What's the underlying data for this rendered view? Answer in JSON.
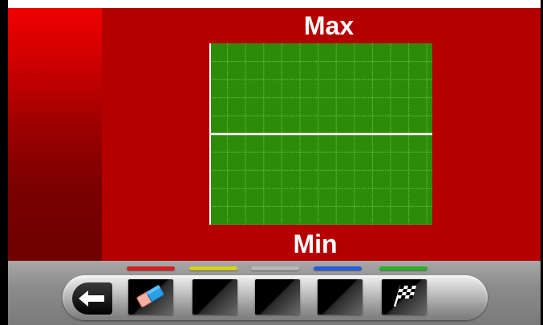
{
  "screen": {
    "max_label": "Max",
    "min_label": "Min"
  },
  "plot": {
    "grid": true,
    "background_color": "#2e8b0a",
    "grid_color": "#6fd14a",
    "centerline_color": "#ffffff"
  },
  "toolbar": {
    "indicators": [
      {
        "name": "red-indicator",
        "color": "#d62020"
      },
      {
        "name": "yellow-indicator",
        "color": "#d8d020"
      },
      {
        "name": "gray-indicator",
        "color": "#b8b8b8"
      },
      {
        "name": "blue-indicator",
        "color": "#2a5cd6"
      },
      {
        "name": "green-indicator",
        "color": "#2fb02a"
      }
    ],
    "buttons": [
      {
        "name": "back-button",
        "icon": "arrow-left-icon"
      },
      {
        "name": "erase-button",
        "icon": "eraser-icon"
      },
      {
        "name": "blank-button-1",
        "icon": "none"
      },
      {
        "name": "blank-button-2",
        "icon": "none"
      },
      {
        "name": "blank-button-3",
        "icon": "none"
      },
      {
        "name": "finish-button",
        "icon": "checkered-flag-icon"
      }
    ]
  }
}
